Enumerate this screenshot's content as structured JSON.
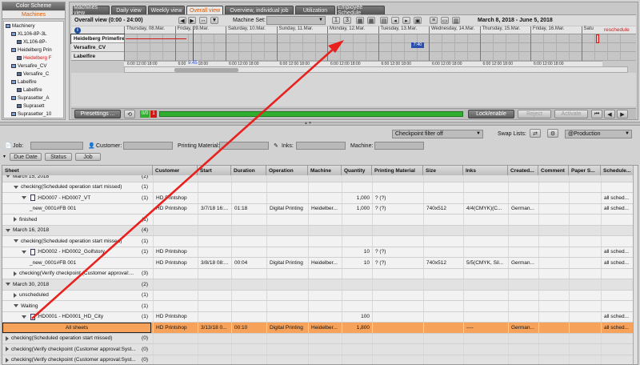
{
  "left_panel": {
    "color_scheme": "Color Scheme",
    "tab": "Machines",
    "tree": [
      {
        "label": "Machinery",
        "indent": 0,
        "icon": "folder"
      },
      {
        "label": "XL106-8P-3L",
        "indent": 1,
        "icon": "folder"
      },
      {
        "label": "XL106-8P-",
        "indent": 2,
        "icon": "machine"
      },
      {
        "label": "Heidelberg Prin",
        "indent": 1,
        "icon": "folder"
      },
      {
        "label": "Heidelberg F",
        "indent": 2,
        "icon": "machine",
        "selected": true
      },
      {
        "label": "Versafire_CV",
        "indent": 1,
        "icon": "folder"
      },
      {
        "label": "Versafire_C",
        "indent": 2,
        "icon": "machine"
      },
      {
        "label": "Labelfire",
        "indent": 1,
        "icon": "folder"
      },
      {
        "label": "Labelfire",
        "indent": 2,
        "icon": "machine"
      },
      {
        "label": "Suprasetter_A",
        "indent": 1,
        "icon": "folder"
      },
      {
        "label": "Suprasett",
        "indent": 2,
        "icon": "machine"
      },
      {
        "label": "Suprasetter_10",
        "indent": 1,
        "icon": "folder"
      }
    ]
  },
  "tabs": [
    "Machines view",
    "Daily view",
    "Weekly view",
    "Overall view",
    "Overview, individual job",
    "Utilization",
    "Employee Schedule"
  ],
  "overall_view": "Overall view (0:00 - 24:00)",
  "machine_set_label": "Machine Set:",
  "date_range": "March 8, 2018 - June 5, 2018",
  "timeline_days": [
    "Thursday, 08.Mar.",
    "Friday, 09.Mar.",
    "Saturday, 10.Mar.",
    "Sunday, 11.Mar.",
    "Monday, 12.Mar.",
    "Tuesday, 13.Mar.",
    "Wednesday, 14.Mar.",
    "Thursday, 15.Mar.",
    "Friday, 16.Mar.",
    "Satu"
  ],
  "reschedule_label": "reschedule",
  "machines": [
    "Heidelberg Primefire",
    "Versafire_CV",
    "Labelfire"
  ],
  "time_ticks": "6:00 12:00 18:00",
  "current_time": "9:45",
  "job_marker": "7:40",
  "controls": {
    "presettings": "Presettings ...",
    "lock_enable": "Lock/enable",
    "reject": "Reject",
    "activate": "Activate",
    "count_green": "0/0",
    "count_red": "1"
  },
  "filter": {
    "checkpoint": "Checkpoint filter off",
    "swap_lists": "Swap Lists:",
    "production": "@Production"
  },
  "search": {
    "job": "Job:",
    "customer": "Customer:",
    "printing_material": "Printing Material:",
    "inks": "Inks:",
    "machine": "Machine:"
  },
  "sort": {
    "due_date": "Due Date",
    "status": "Status",
    "job": "Job"
  },
  "columns": [
    "Sheet",
    "Customer",
    "Start",
    "Duration",
    "Operation",
    "Machine",
    "Quantity",
    "Printing Material",
    "Size",
    "Inks",
    "Created...",
    "Comment",
    "Paper S...",
    "Schedule..."
  ],
  "rows": [
    {
      "indent": 0,
      "tri": "d",
      "text": "March 15, 2018",
      "count": "(2)",
      "cells": {}
    },
    {
      "indent": 1,
      "tri": "d",
      "text": "checking(Scheduled operation start missed)",
      "count": "(1)",
      "cells": {}
    },
    {
      "indent": 2,
      "tri": "d",
      "doc": true,
      "text": "HD0007 - HD0007_VT",
      "count": "(1)",
      "cells": {
        "customer": "HD Printshop",
        "quantity": "1,000",
        "material": "? (?)",
        "sched": "all sched..."
      }
    },
    {
      "indent": 3,
      "text": "_new_0001#FB 001",
      "count": "",
      "cells": {
        "customer": "HD Printshop",
        "start": "3/7/18 16:...",
        "duration": "01:18",
        "operation": "Digital Printing",
        "machine": "Heidelber...",
        "quantity": "1,000",
        "material": "? (?)",
        "size": "740x512",
        "inks": "4/4(CMYK)(C...",
        "created": "German...",
        "sched": "all sched..."
      }
    },
    {
      "indent": 1,
      "tri": "r",
      "text": "finished",
      "count": "(1)",
      "cells": {}
    },
    {
      "indent": 0,
      "tri": "d",
      "text": "March 16, 2018",
      "count": "(4)",
      "cells": {}
    },
    {
      "indent": 1,
      "tri": "d",
      "text": "checking(Scheduled operation start missed)",
      "count": "(1)",
      "cells": {}
    },
    {
      "indent": 2,
      "tri": "d",
      "doc": true,
      "text": "HD0002 - HD0002_Golfstory",
      "count": "(1)",
      "cells": {
        "customer": "HD Printshop",
        "quantity": "10",
        "material": "? (?)",
        "sched": "all sched..."
      }
    },
    {
      "indent": 3,
      "text": "_new_0001#FB 001",
      "count": "",
      "cells": {
        "customer": "HD Printshop",
        "start": "3/8/18 08:...",
        "duration": "00:04",
        "operation": "Digital Printing",
        "machine": "Heidelber...",
        "quantity": "10",
        "material": "? (?)",
        "size": "740x512",
        "inks": "5/5(CMYK, Sil...",
        "created": "German...",
        "sched": "all sched..."
      }
    },
    {
      "indent": 1,
      "tri": "r",
      "text": "checking(Verify checkpoint (Customer approval:...",
      "count": "(3)",
      "cells": {}
    },
    {
      "indent": 0,
      "tri": "d",
      "text": "March 30, 2018",
      "count": "(2)",
      "cells": {}
    },
    {
      "indent": 1,
      "tri": "r",
      "text": "unscheduled",
      "count": "(1)",
      "cells": {}
    },
    {
      "indent": 1,
      "tri": "d",
      "text": "Waiting",
      "count": "(1)",
      "cells": {}
    },
    {
      "indent": 2,
      "tri": "d",
      "doc": true,
      "text": "HD0001 - HD0001_HD_City",
      "count": "(1)",
      "cells": {
        "customer": "HD Printshop",
        "quantity": "100",
        "sched": "all sched..."
      }
    },
    {
      "indent": 3,
      "text": "All sheets",
      "count": "",
      "highlight": true,
      "cells": {
        "customer": "HD Printshop",
        "start": "3/13/18 0...",
        "duration": "00:10",
        "operation": "Digital Printing",
        "machine": "Heidelber...",
        "quantity": "1,800",
        "inks": "----",
        "created": "German...",
        "sched": "all sched..."
      }
    },
    {
      "indent": 0,
      "tri": "r",
      "text": "checking(Scheduled operation start missed)",
      "count": "(0)",
      "cells": {}
    },
    {
      "indent": 0,
      "tri": "r",
      "text": "checking(Verify checkpoint (Customer approval:Syst...",
      "count": "(0)",
      "cells": {}
    },
    {
      "indent": 0,
      "tri": "r",
      "text": "checking(Verify checkpoint (Customer approval:Syst...",
      "count": "(0)",
      "cells": {}
    }
  ],
  "colors": {
    "accent": "#e05a00",
    "highlight_row": "#f6a25a",
    "arrow": "#e8201e",
    "green_bar": "#2fae2f",
    "red": "#d01818"
  }
}
